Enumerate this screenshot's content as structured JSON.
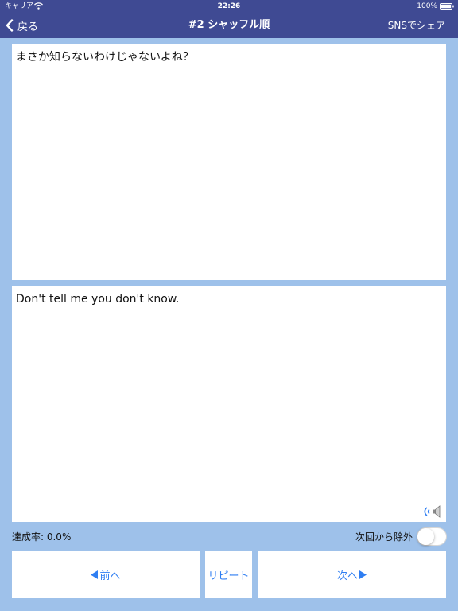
{
  "status_bar": {
    "carrier": "キャリア",
    "time": "22:26",
    "battery": "100%"
  },
  "nav": {
    "back_label": "戻る",
    "title": "#2 シャッフル順",
    "share_label": "SNSでシェア"
  },
  "card": {
    "question": "まさか知らないわけじゃないよね？",
    "answer": "Don't tell me you don't know."
  },
  "footer": {
    "progress": "達成率: 0.0%",
    "exclude_label": "次回から除外",
    "exclude_enabled": false
  },
  "buttons": {
    "prev_label": "前へ",
    "repeat_label": "リピート",
    "next_label": "次へ"
  },
  "colors": {
    "nav_background": "#3f4a93",
    "page_background": "#9ec1ea",
    "accent": "#2f7ef2"
  },
  "icons": {
    "back": "chevron-left-icon",
    "wifi": "wifi-icon",
    "battery": "battery-icon",
    "speaker": "speaker-icon",
    "prev_arrow": "triangle-left-icon",
    "next_arrow": "triangle-right-icon"
  }
}
